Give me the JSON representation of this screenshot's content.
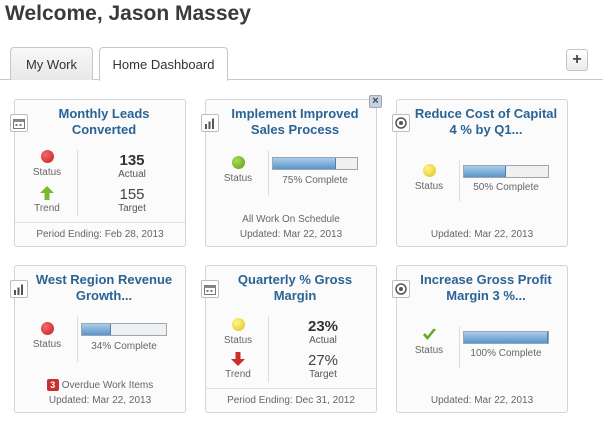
{
  "header": {
    "welcome": "Welcome, Jason Massey"
  },
  "tabs": [
    {
      "label": "My Work"
    },
    {
      "label": "Home Dashboard"
    }
  ],
  "add_button": "+",
  "close_button": "×",
  "labels": {
    "status": "Status",
    "trend": "Trend",
    "actual": "Actual",
    "target": "Target"
  },
  "cards": [
    {
      "title": "Monthly Leads Converted",
      "type_icon": "calendar-icon",
      "status_color": "red",
      "trend": "up-arrow-icon",
      "actual": "135",
      "target": "155",
      "footer": "Period Ending: Feb 28, 2013"
    },
    {
      "title": "Implement Improved Sales Process",
      "type_icon": "bar-chart-icon",
      "status_color": "green",
      "progress": 0.75,
      "progress_label": "75% Complete",
      "note": "All Work On Schedule",
      "footer": "Updated: Mar 22, 2013"
    },
    {
      "title": "Reduce Cost of Capital 4 % by Q1...",
      "type_icon": "target-icon",
      "status_color": "yellow",
      "progress": 0.5,
      "progress_label": "50% Complete",
      "footer": "Updated: Mar 22, 2013"
    },
    {
      "title": "West Region Revenue Growth...",
      "type_icon": "bar-chart-icon",
      "status_color": "red",
      "progress": 0.34,
      "progress_label": "34% Complete",
      "overdue_count": "3",
      "overdue_label": "Overdue Work Items",
      "footer": "Updated: Mar 22, 2013"
    },
    {
      "title": "Quarterly % Gross Margin",
      "type_icon": "calendar-icon",
      "status_color": "yellow",
      "trend": "down-arrow-icon",
      "actual": "23%",
      "target": "27%",
      "footer": "Period Ending: Dec 31, 2012"
    },
    {
      "title": "Increase Gross Profit Margin 3 %...",
      "type_icon": "target-icon",
      "status_color": "green-check",
      "progress": 1.0,
      "progress_label": "100% Complete",
      "footer": "Updated: Mar 22, 2013"
    }
  ]
}
